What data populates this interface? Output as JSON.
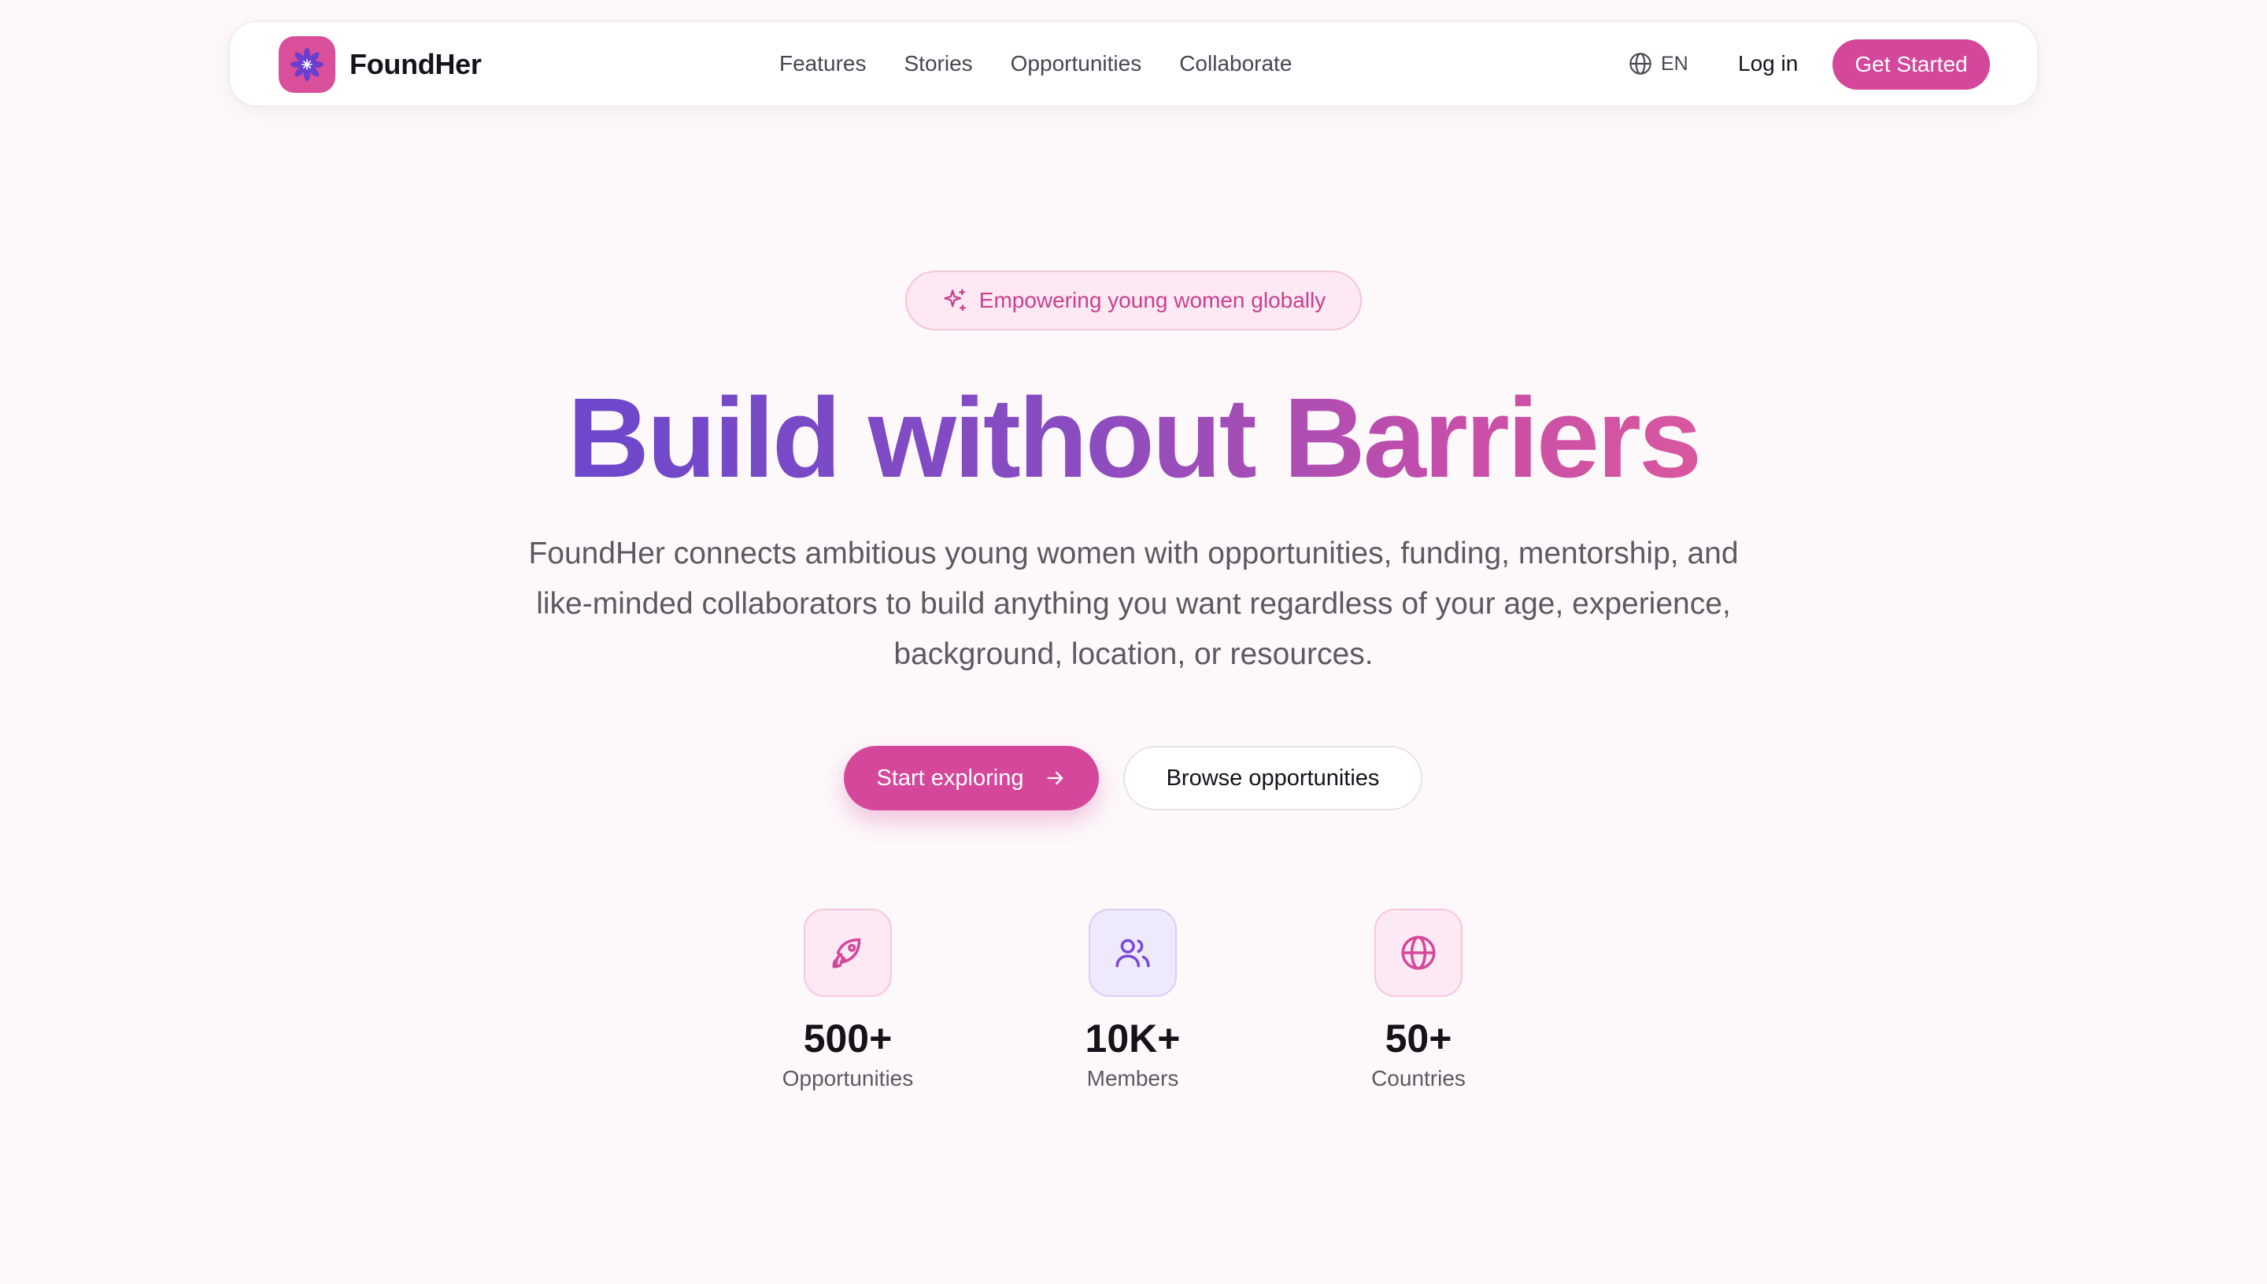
{
  "nav": {
    "brand": "FoundHer",
    "links": [
      "Features",
      "Stories",
      "Opportunities",
      "Collaborate"
    ],
    "language": "EN",
    "login": "Log in",
    "cta": "Get Started"
  },
  "hero": {
    "badge": "Empowering young women globally",
    "headline": "Build without Barriers",
    "subtitle": "FoundHer connects ambitious young women with opportunities, funding, mentorship, and like-minded collaborators to build anything you want regardless of your age, experience, background, location, or resources.",
    "primary_cta": "Start exploring",
    "secondary_cta": "Browse opportunities"
  },
  "stats": [
    {
      "icon": "rocket-icon",
      "value": "500+",
      "label": "Opportunities"
    },
    {
      "icon": "users-icon",
      "value": "10K+",
      "label": "Members"
    },
    {
      "icon": "globe-icon",
      "value": "50+",
      "label": "Countries"
    }
  ],
  "colors": {
    "accent": "#d4479a",
    "gradient_start": "#6c48cc",
    "gradient_end": "#d8579e",
    "background": "#fdf9fb"
  }
}
